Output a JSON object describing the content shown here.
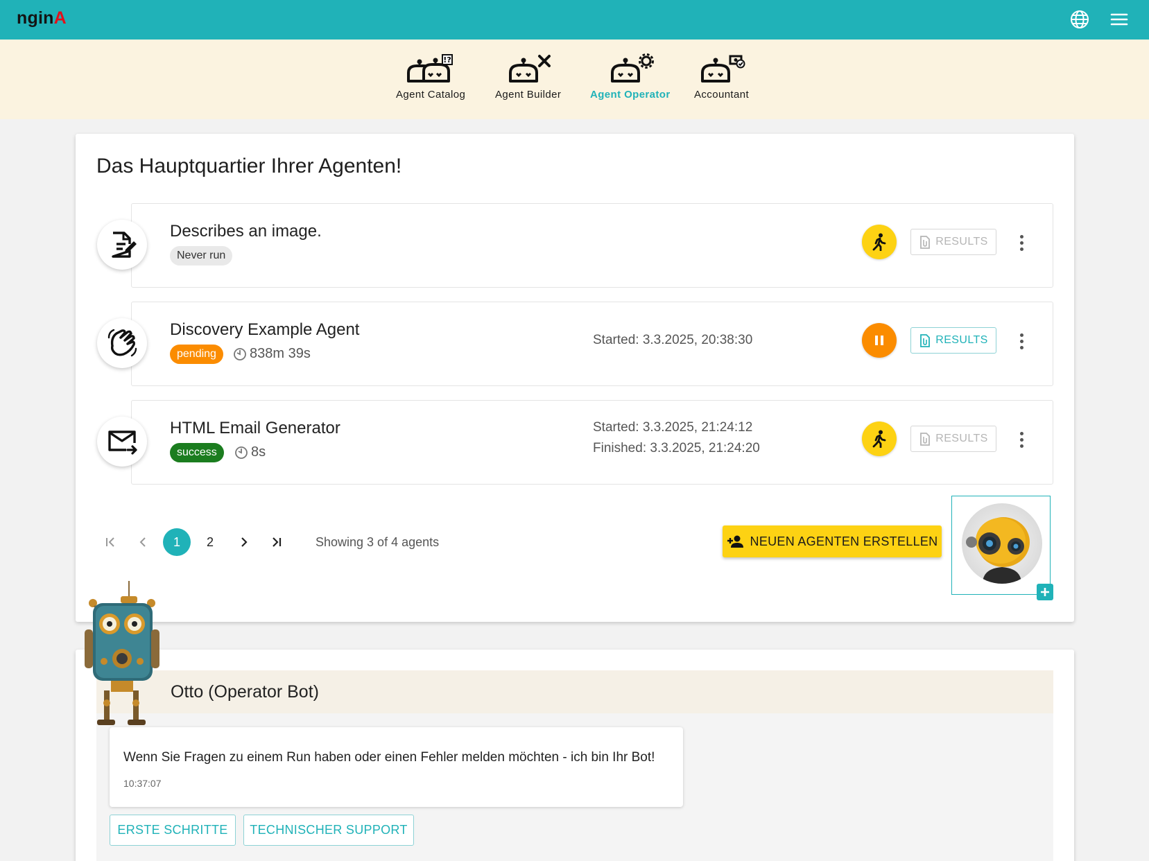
{
  "header": {
    "logo_main": "ngin",
    "logo_accent": "A",
    "icons": [
      "globe-icon",
      "menu-icon"
    ]
  },
  "nav": {
    "items": [
      {
        "label": "Agent Catalog",
        "icon": "robot-catalog-icon",
        "active": false
      },
      {
        "label": "Agent Builder",
        "icon": "robot-builder-icon",
        "active": false
      },
      {
        "label": "Agent Operator",
        "icon": "robot-operator-icon",
        "active": true
      },
      {
        "label": "Accountant",
        "icon": "robot-accountant-icon",
        "active": false
      }
    ]
  },
  "main": {
    "title": "Das Hauptquartier Ihrer Agenten!",
    "agents": [
      {
        "name": "Describes an image.",
        "icon": "document-edit-icon",
        "status": "Never run",
        "status_color": "#e9e9e9",
        "duration": "",
        "started": "",
        "finished": "",
        "action_icon": "run-icon",
        "results_label": "RESULTS",
        "results_enabled": false
      },
      {
        "name": "Discovery Example Agent",
        "icon": "hand-wave-icon",
        "status": "pending",
        "status_color": "#fb8c00",
        "duration": "838m 39s",
        "started": "Started: 3.3.2025, 20:38:30",
        "finished": "",
        "action_icon": "pause-icon",
        "results_label": "RESULTS",
        "results_enabled": true
      },
      {
        "name": "HTML Email Generator",
        "icon": "email-forward-icon",
        "status": "success",
        "status_color": "#1b7d1f",
        "duration": "8s",
        "started": "Started: 3.3.2025, 21:24:12",
        "finished": "Finished: 3.3.2025, 21:24:20",
        "action_icon": "run-icon",
        "results_label": "RESULTS",
        "results_enabled": false
      }
    ],
    "pagination": {
      "pages": [
        "1",
        "2"
      ],
      "current": "1",
      "info": "Showing 3 of 4 agents"
    },
    "create_button": "NEUEN AGENTEN ERSTELLEN"
  },
  "chat": {
    "title": "Otto (Operator Bot)",
    "message": "Wenn Sie Fragen zu einem Run haben oder einen Fehler melden möchten - ich bin Ihr Bot!",
    "time": "10:37:07",
    "chips": [
      "ERSTE SCHRITTE",
      "TECHNISCHER SUPPORT"
    ]
  },
  "colors": {
    "accent": "#20b2b8",
    "yellow": "#fdd213",
    "orange": "#fb8c00",
    "success": "#1b7d1f",
    "nav_background": "#fbf3e0"
  }
}
